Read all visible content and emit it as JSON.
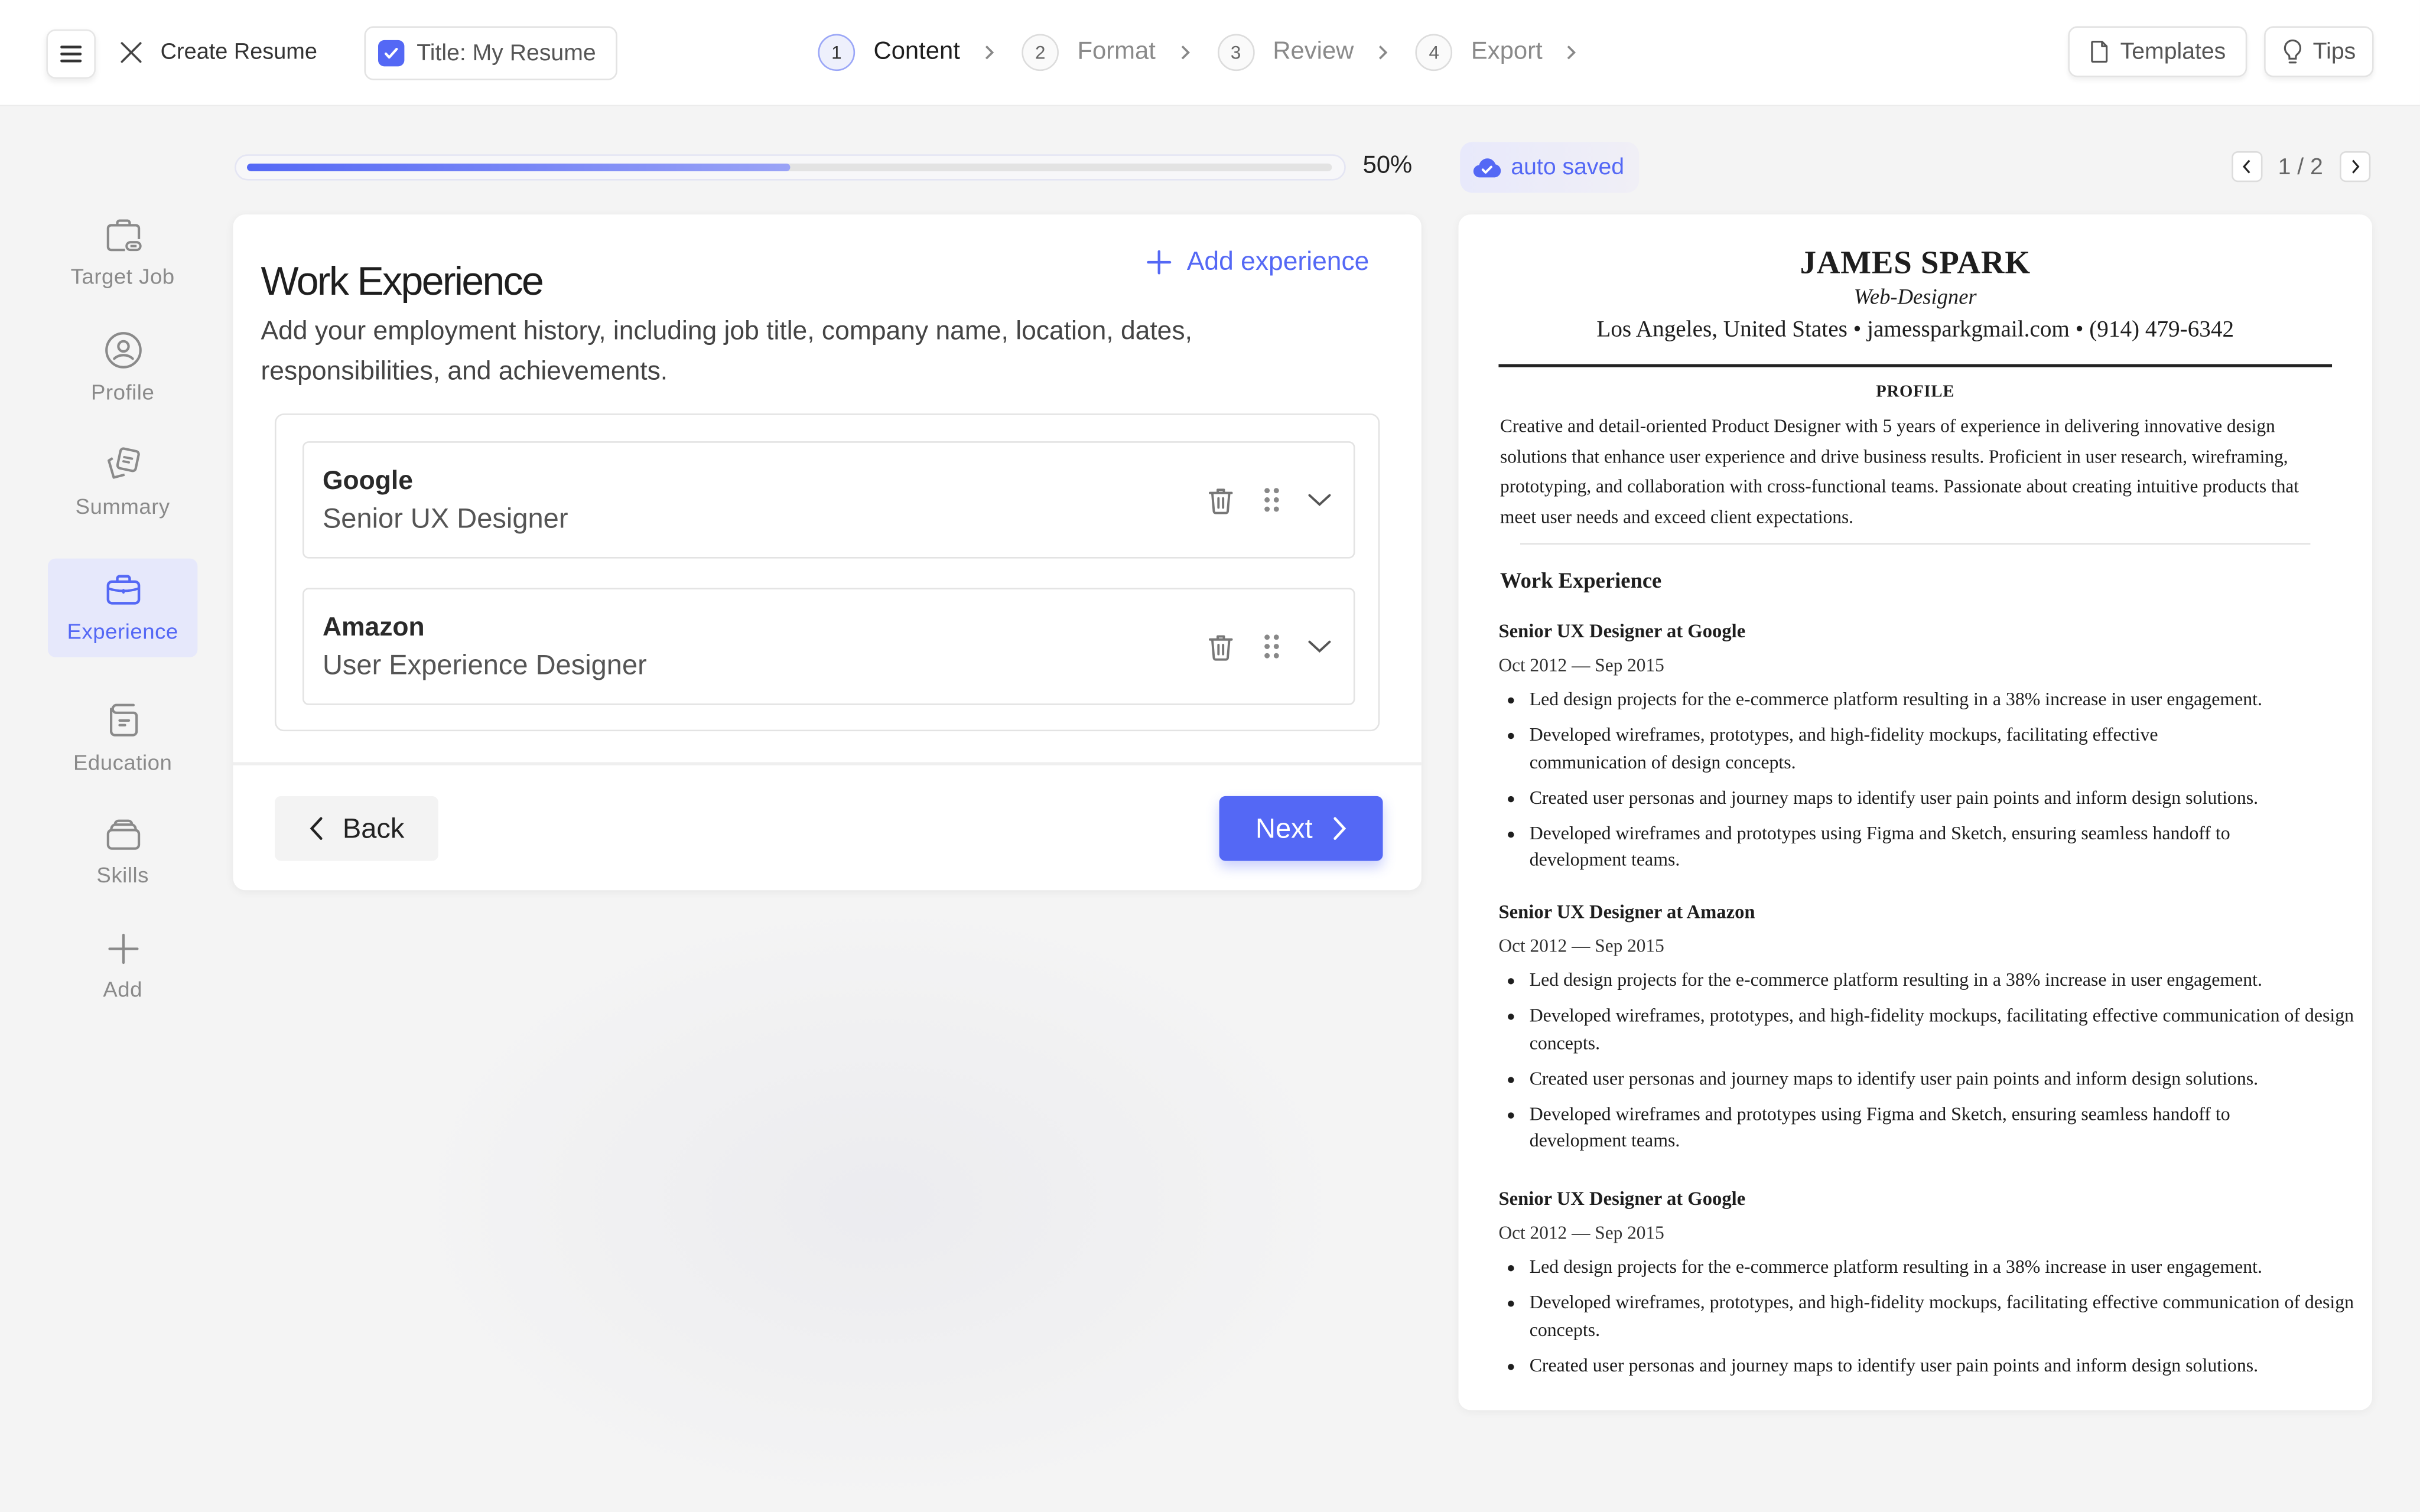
{
  "header": {
    "menu_icon": "hamburger-icon",
    "close_icon": "close-icon",
    "page_title": "Create Resume",
    "resume_title": "Title: My Resume",
    "resume_title_checked": true,
    "steps": [
      {
        "number": "1",
        "label": "Content",
        "active": true
      },
      {
        "number": "2",
        "label": "Format",
        "active": false
      },
      {
        "number": "3",
        "label": "Review",
        "active": false
      },
      {
        "number": "4",
        "label": "Export",
        "active": false
      }
    ],
    "templates_label": "Templates",
    "tips_label": "Tips"
  },
  "sidebar": {
    "items": [
      {
        "label": "Target Job",
        "icon": "briefcase-link-icon",
        "active": false
      },
      {
        "label": "Profile",
        "icon": "user-circle-icon",
        "active": false
      },
      {
        "label": "Summary",
        "icon": "notes-icon",
        "active": false
      },
      {
        "label": "Experience",
        "icon": "briefcase-icon",
        "active": true
      },
      {
        "label": "Education",
        "icon": "book-icon",
        "active": false
      },
      {
        "label": "Skills",
        "icon": "stack-icon",
        "active": false
      },
      {
        "label": "Add",
        "icon": "plus-icon",
        "active": false
      }
    ]
  },
  "progress": {
    "percent": 50,
    "label": "50%"
  },
  "editor": {
    "title": "Work Experience",
    "add_label": "Add experience",
    "description": "Add your employment history, including job title, company name, location, dates, responsibilities, and achievements.",
    "experiences": [
      {
        "company": "Google",
        "role": "Senior UX Designer"
      },
      {
        "company": "Amazon",
        "role": "User Experience Designer"
      }
    ],
    "back_label": "Back",
    "next_label": "Next"
  },
  "preview": {
    "autosave_label": "auto saved",
    "page_indicator": "1 / 2",
    "resume": {
      "name": "JAMES SPARK",
      "role": "Web-Designer",
      "contact": "Los Angeles, United States • jamessparkgmail.com • (914) 479-6342",
      "profile_heading": "PROFILE",
      "profile_text": "Creative and detail-oriented Product Designer with 5 years of experience in delivering innovative design solutions that enhance user experience and drive business results. Proficient in user research, wireframing, prototyping, and collaboration with cross-functional teams. Passionate about creating intuitive products that meet user needs and exceed client expectations.",
      "work_heading": "Work Experience",
      "jobs": [
        {
          "title": "Senior UX Designer at Google",
          "dates": "Oct 2012 — Sep 2015",
          "bullets": [
            "Led design projects for the e-commerce platform resulting in a 38% increase in user engagement.",
            "Developed wireframes, prototypes, and high-fidelity mockups, facilitating effective communication of design concepts.",
            "Created user personas and journey maps to identify user pain points and inform design solutions.",
            "Developed wireframes and prototypes using Figma and Sketch, ensuring seamless handoff to development teams."
          ]
        },
        {
          "title": "Senior UX Designer at Amazon",
          "dates": "Oct 2012 — Sep 2015",
          "bullets": [
            "Led design projects for the e-commerce platform resulting in a 38% increase in user engagement.",
            "Developed wireframes, prototypes, and high-fidelity mockups, facilitating effective communication of design concepts.",
            "Created user personas and journey maps to identify user pain points and inform design solutions.",
            "Developed wireframes and prototypes using Figma and Sketch, ensuring seamless handoff to development teams."
          ]
        },
        {
          "title": "Senior UX Designer at Google",
          "dates": "Oct 2012 — Sep 2015",
          "bullets": [
            "Led design projects for the e-commerce platform resulting in a 38% increase in user engagement.",
            "Developed wireframes, prototypes, and high-fidelity mockups, facilitating effective communication of design concepts.",
            "Created user personas and journey maps to identify user pain points and inform design solutions."
          ]
        }
      ]
    }
  },
  "colors": {
    "accent": "#5468f5",
    "accent_light": "#e6e8fb",
    "background": "#f4f4f4"
  }
}
